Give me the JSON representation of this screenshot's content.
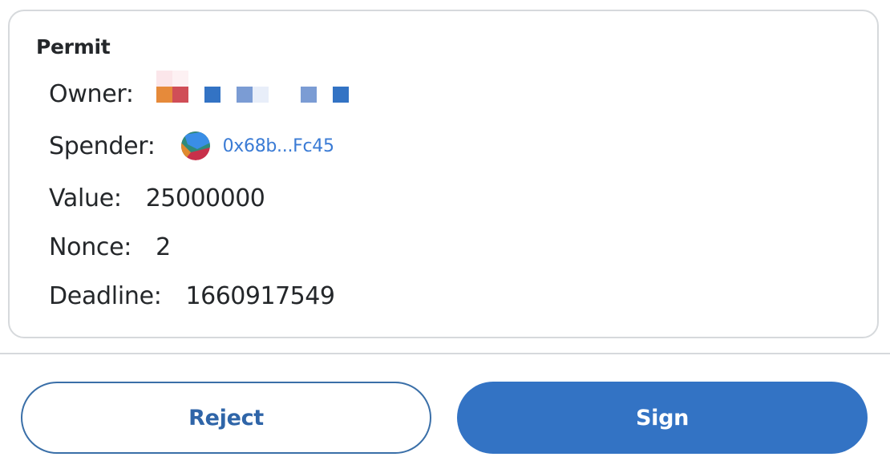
{
  "card": {
    "title": "Permit",
    "owner": {
      "label": "Owner:"
    },
    "spender": {
      "label": "Spender:",
      "address": "0x68b...Fc45"
    },
    "value": {
      "label": "Value:",
      "value": "25000000"
    },
    "nonce": {
      "label": "Nonce:",
      "value": "2"
    },
    "deadline": {
      "label": "Deadline:",
      "value": "1660917549"
    }
  },
  "actions": {
    "reject_label": "Reject",
    "sign_label": "Sign"
  },
  "colors": {
    "link": "#3a7bd5",
    "primary": "#3373c4",
    "border": "#d6d9dc",
    "text": "#24272a"
  },
  "icons": {
    "owner_identicon": "blockies-identicon",
    "spender_avatar": "jazzicon-avatar"
  }
}
